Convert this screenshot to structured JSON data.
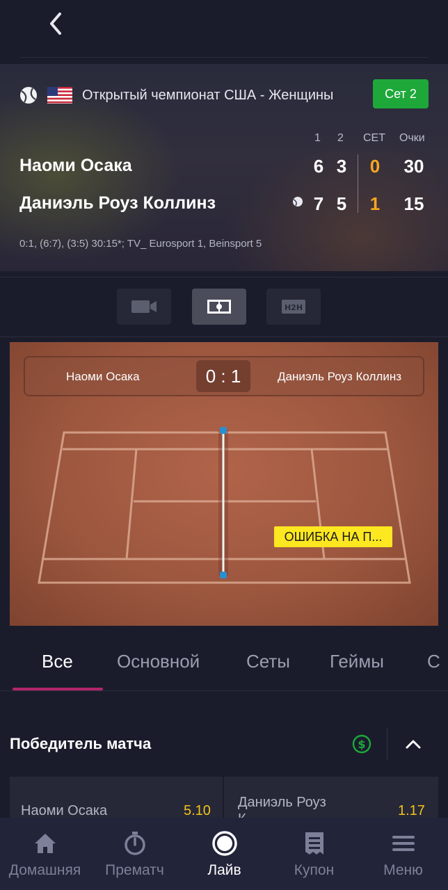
{
  "header": {
    "back_icon": "chevron-left-icon"
  },
  "event": {
    "tournament": "Открытый чемпионат США - Женщины",
    "flag": "usa-flag-icon",
    "set_badge": "Сет 2",
    "columns": [
      "1",
      "2",
      "СЕТ",
      "Очки"
    ],
    "players": [
      {
        "name": "Наоми Осака",
        "set1": "6",
        "set2": "3",
        "sets": "0",
        "points": "30",
        "serving": false
      },
      {
        "name": "Даниэль Роуз Коллинз",
        "set1": "7",
        "set2": "5",
        "sets": "1",
        "points": "15",
        "serving": true
      }
    ],
    "info": "0:1, (6:7), (3:5) 30:15*;  TV_ Eurosport 1, Beinsport 5"
  },
  "view_modes": [
    {
      "id": "video",
      "icon": "video-camera-icon",
      "active": false
    },
    {
      "id": "field",
      "icon": "field-icon",
      "active": true
    },
    {
      "id": "h2h",
      "icon": "h2h-icon",
      "label": "H2H",
      "active": false
    }
  ],
  "court": {
    "left_player": "Наоми Осака",
    "right_player": "Даниэль Роуз Коллинз",
    "score": "0 : 1",
    "event_tag": "ОШИБКА НА П..."
  },
  "tabs": [
    {
      "label": "Все",
      "active": true
    },
    {
      "label": "Основной",
      "active": false
    },
    {
      "label": "Сеты",
      "active": false
    },
    {
      "label": "Геймы",
      "active": false
    },
    {
      "label": "С",
      "active": false
    }
  ],
  "market": {
    "title": "Победитель матча",
    "cashout_icon": "dollar-circle-icon",
    "collapse_icon": "chevron-up-icon",
    "odds": [
      {
        "name": "Наоми Осака",
        "value": "5.10"
      },
      {
        "name": "Даниэль Роуз",
        "name_line2": "К",
        "value": "1.17"
      }
    ]
  },
  "colors": {
    "accent": "#b4256b",
    "live_green": "#1ea83a",
    "odds_gold": "#f2c21b",
    "sets_gold": "#f5a623",
    "event_yellow": "#fde720"
  },
  "bottom_nav": [
    {
      "label": "Домашняя",
      "icon": "home-icon",
      "active": false
    },
    {
      "label": "Прематч",
      "icon": "stopwatch-icon",
      "active": false
    },
    {
      "label": "Лайв",
      "icon": "live-icon",
      "active": true
    },
    {
      "label": "Купон",
      "icon": "coupon-icon",
      "active": false
    },
    {
      "label": "Меню",
      "icon": "menu-icon",
      "active": false
    }
  ]
}
